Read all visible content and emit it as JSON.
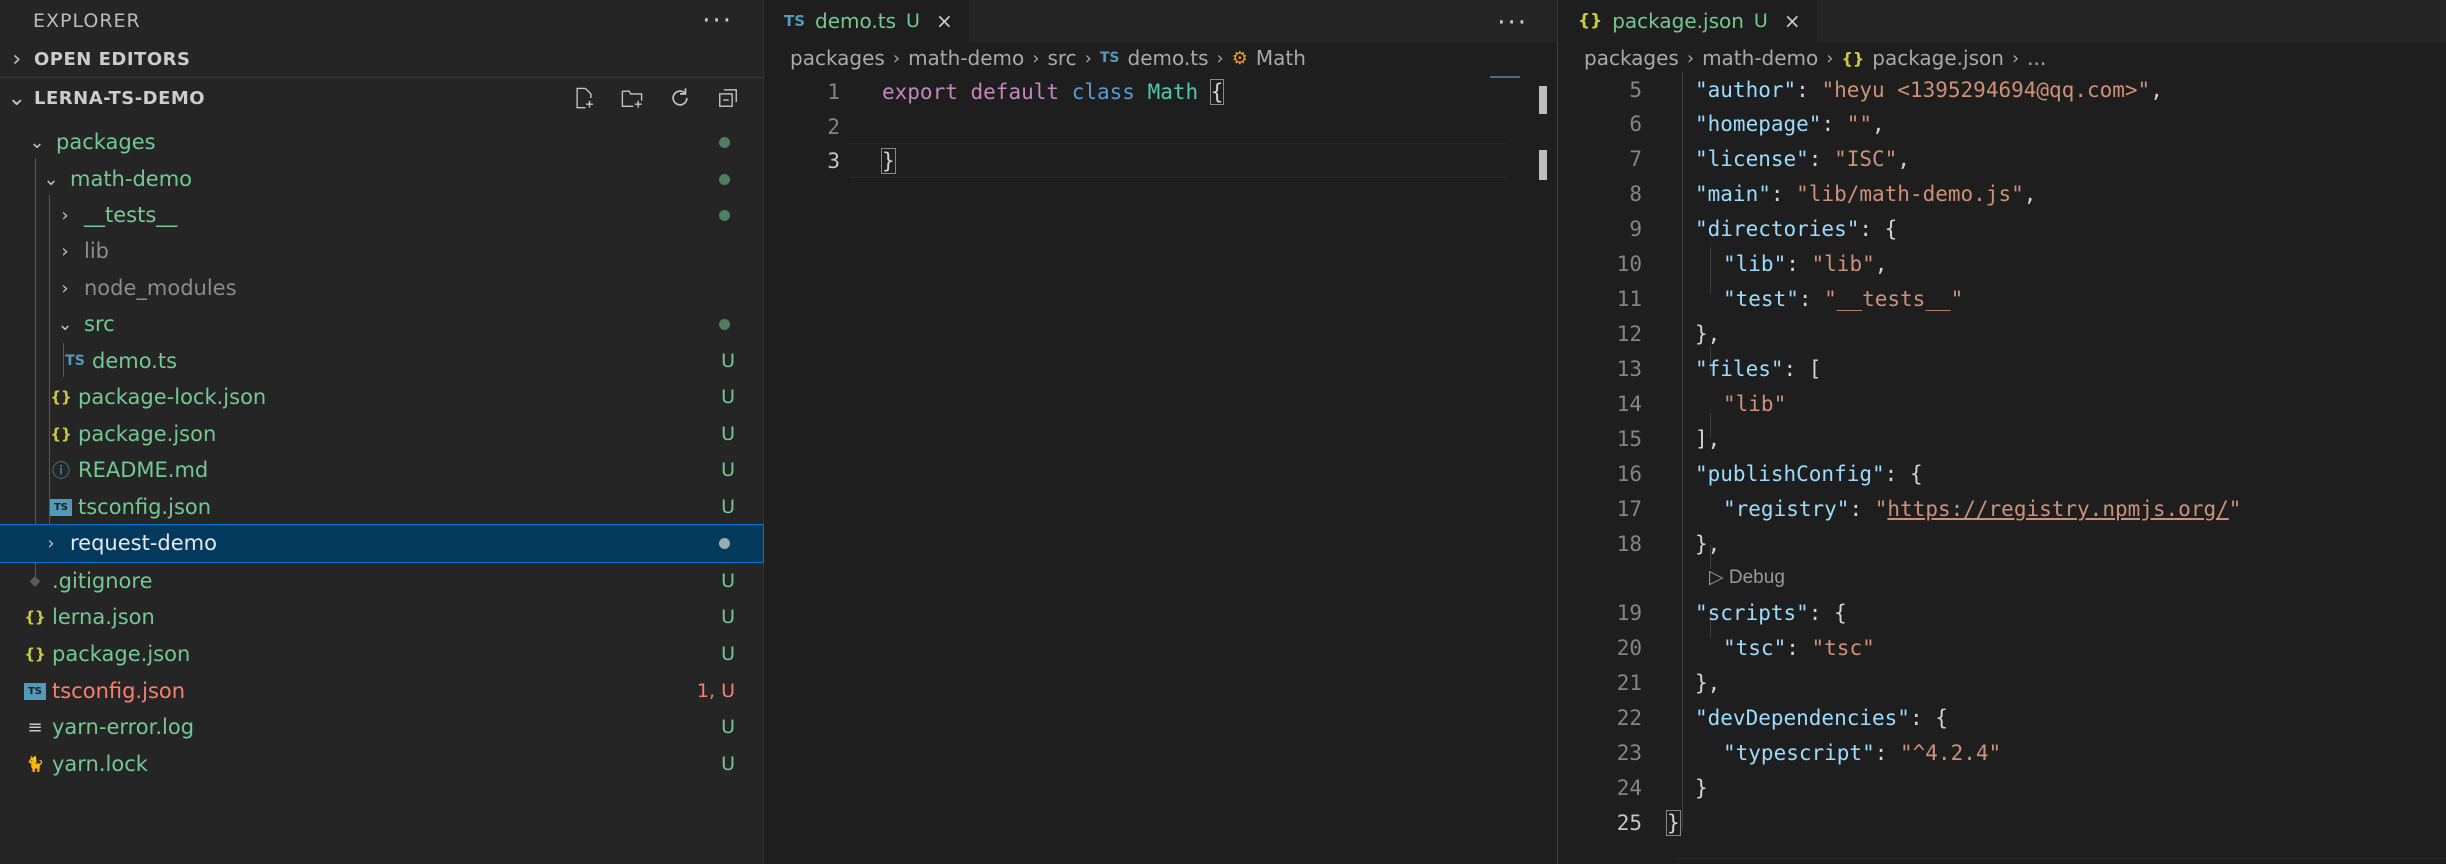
{
  "explorer": {
    "title": "EXPLORER",
    "more": "···",
    "open_editors": "OPEN EDITORS",
    "workspace": "LERNA-TS-DEMO",
    "items": [
      {
        "label": "packages",
        "status": ""
      },
      {
        "label": "math-demo",
        "status": ""
      },
      {
        "label": "__tests__",
        "status": ""
      },
      {
        "label": "lib",
        "status": ""
      },
      {
        "label": "node_modules",
        "status": ""
      },
      {
        "label": "src",
        "status": ""
      },
      {
        "label": "demo.ts",
        "status": "U",
        "icon": "TS"
      },
      {
        "label": "package-lock.json",
        "status": "U",
        "icon": "{}"
      },
      {
        "label": "package.json",
        "status": "U",
        "icon": "{}"
      },
      {
        "label": "README.md",
        "status": "U",
        "icon": "ⓘ"
      },
      {
        "label": "tsconfig.json",
        "status": "U",
        "icon": "TS"
      },
      {
        "label": "request-demo",
        "status": ""
      },
      {
        "label": ".gitignore",
        "status": "U",
        "icon": "◆"
      },
      {
        "label": "lerna.json",
        "status": "U",
        "icon": "{}"
      },
      {
        "label": "package.json",
        "status": "U",
        "icon": "{}"
      },
      {
        "label": "tsconfig.json",
        "status": "1, U",
        "icon": "TS"
      },
      {
        "label": "yarn-error.log",
        "status": "U",
        "icon": "≡"
      },
      {
        "label": "yarn.lock",
        "status": "U",
        "icon": "🐈"
      }
    ]
  },
  "editor_left": {
    "tab": {
      "icon": "TS",
      "name": "demo.ts",
      "status": "U",
      "close": "×"
    },
    "more": "···",
    "breadcrumb": {
      "p1": "packages",
      "p2": "math-demo",
      "p3": "src",
      "p4_icon": "TS",
      "p4": "demo.ts",
      "p5": "Math"
    },
    "lines": [
      {
        "n": "1",
        "kw1": "export",
        "kw2": "default",
        "kw3": "class",
        "name": "Math",
        "brace": "{"
      },
      {
        "n": "2"
      },
      {
        "n": "3",
        "brace": "}"
      }
    ]
  },
  "editor_right": {
    "tab": {
      "icon": "{}",
      "name": "package.json",
      "status": "U",
      "close": "×"
    },
    "breadcrumb": {
      "p1": "packages",
      "p2": "math-demo",
      "p3_icon": "{}",
      "p3": "package.json",
      "p4": "..."
    },
    "codelens": "▷ Debug",
    "lines": {
      "n5": "5",
      "k5": "\"author\"",
      "v5": "\"heyu <1395294694@qq.com>\"",
      "n6": "6",
      "k6": "\"homepage\"",
      "v6": "\"\"",
      "n7": "7",
      "k7": "\"license\"",
      "v7": "\"ISC\"",
      "n8": "8",
      "k8": "\"main\"",
      "v8": "\"lib/math-demo.js\"",
      "n9": "9",
      "k9": "\"directories\"",
      "n10": "10",
      "k10": "\"lib\"",
      "v10": "\"lib\"",
      "n11": "11",
      "k11": "\"test\"",
      "v11": "\"__tests__\"",
      "n12": "12",
      "n13": "13",
      "k13": "\"files\"",
      "n14": "14",
      "v14": "\"lib\"",
      "n15": "15",
      "n16": "16",
      "k16": "\"publishConfig\"",
      "n17": "17",
      "k17": "\"registry\"",
      "v17q": "\"",
      "v17": "https://registry.npmjs.org/",
      "n18": "18",
      "n19": "19",
      "k19": "\"scripts\"",
      "n20": "20",
      "k20": "\"tsc\"",
      "v20": "\"tsc\"",
      "n21": "21",
      "n22": "22",
      "k22": "\"devDependencies\"",
      "n23": "23",
      "k23": "\"typescript\"",
      "v23": "\"^4.2.4\"",
      "n24": "24",
      "n25": "25"
    }
  }
}
